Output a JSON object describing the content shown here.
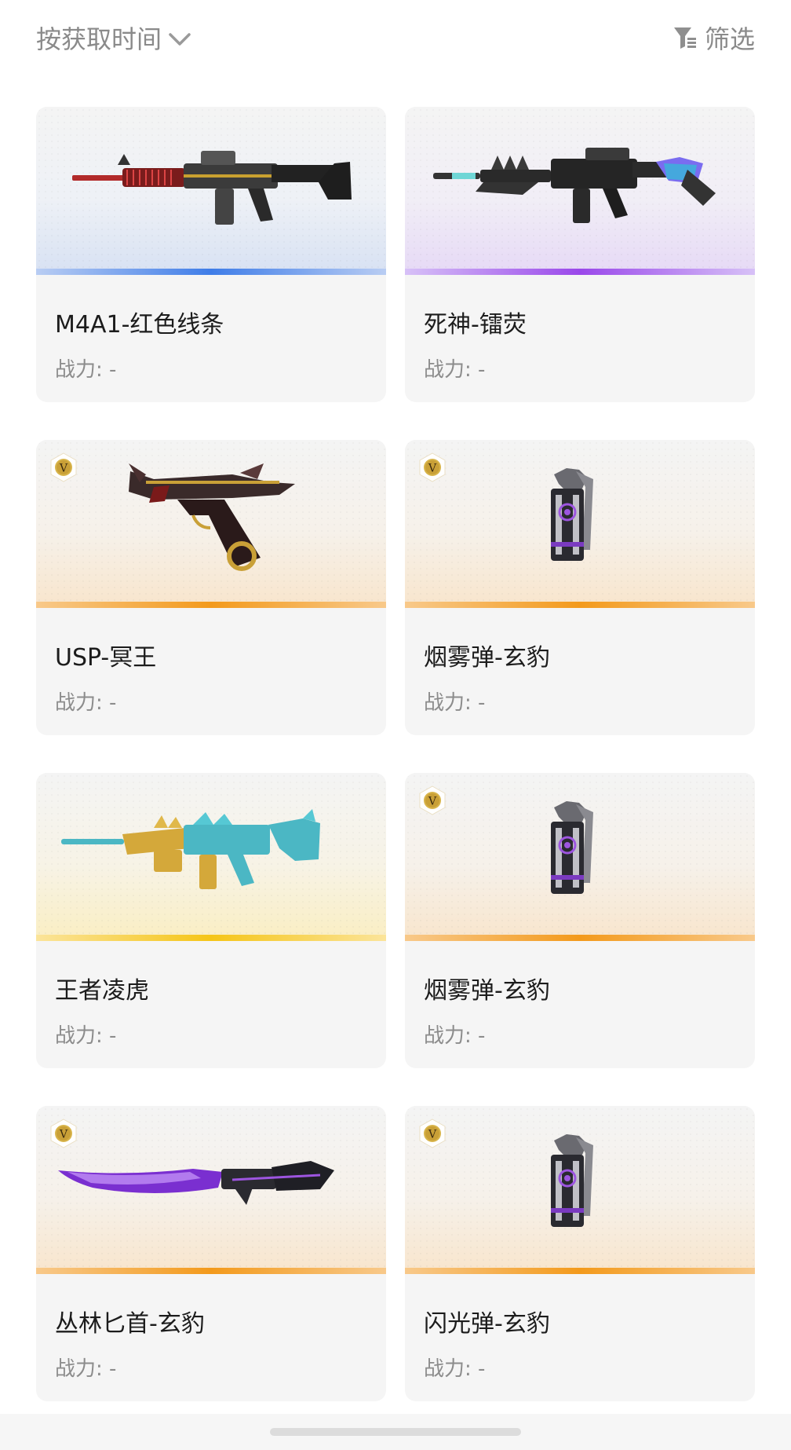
{
  "toolbar": {
    "sort_label": "按获取时间",
    "sort_icon": "chevron-down-icon",
    "filter_label": "筛选",
    "filter_icon": "funnel-icon"
  },
  "items": [
    {
      "name": "M4A1-红色线条",
      "power": "战力: -",
      "rarity": "blue",
      "vip": false,
      "art": "rifle-red-icon"
    },
    {
      "name": "死神-镭荧",
      "power": "战力: -",
      "rarity": "purple",
      "vip": false,
      "art": "rifle-neon-icon"
    },
    {
      "name": "USP-冥王",
      "power": "战力: -",
      "rarity": "orange",
      "vip": true,
      "art": "pistol-dragon-icon"
    },
    {
      "name": "烟雾弹-玄豹",
      "power": "战力: -",
      "rarity": "orange",
      "vip": true,
      "art": "smoke-grenade-icon"
    },
    {
      "name": "王者凌虎",
      "power": "战力: -",
      "rarity": "yellow",
      "vip": false,
      "art": "rifle-tiger-icon"
    },
    {
      "name": "烟雾弹-玄豹",
      "power": "战力: -",
      "rarity": "orange",
      "vip": true,
      "art": "smoke-grenade-icon"
    },
    {
      "name": "丛林匕首-玄豹",
      "power": "战力: -",
      "rarity": "orange",
      "vip": true,
      "art": "knife-panther-icon"
    },
    {
      "name": "闪光弹-玄豹",
      "power": "战力: -",
      "rarity": "orange",
      "vip": true,
      "art": "flash-grenade-icon"
    }
  ],
  "badge_letter": "V"
}
